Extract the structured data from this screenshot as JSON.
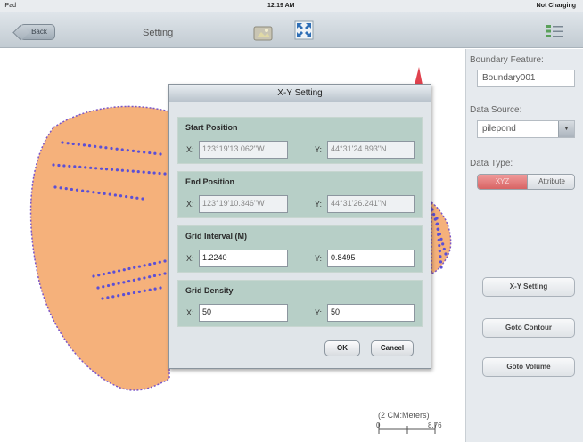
{
  "status_bar": {
    "device": "iPad",
    "time": "12:19 AM",
    "battery": "Not Charging"
  },
  "nav": {
    "back_label": "Back",
    "title": "Setting"
  },
  "icons": {
    "wifi": "wifi-icon",
    "picture": "landscape-picture-icon",
    "fullscreen": "fullscreen-arrows-icon",
    "list": "legend-list-icon"
  },
  "right_panel": {
    "boundary_feature_label": "Boundary Feature:",
    "boundary_feature_value": "Boundary001",
    "data_source_label": "Data Source:",
    "data_source_value": "pilepond",
    "data_type_label": "Data Type:",
    "data_type_options": [
      "XYZ",
      "Attribute"
    ],
    "data_type_selected": "XYZ",
    "buttons": {
      "xy_setting": "X-Y Setting",
      "goto_contour": "Goto Contour",
      "goto_volume": "Goto Volume"
    }
  },
  "dialog": {
    "title": "X-Y Setting",
    "start_position": {
      "label": "Start Position",
      "x_label": "X:",
      "x_value": "123°19'13.062\"W",
      "y_label": "Y:",
      "y_value": "44°31'24.893\"N"
    },
    "end_position": {
      "label": "End Position",
      "x_label": "X:",
      "x_value": "123°19'10.346\"W",
      "y_label": "Y:",
      "y_value": "44°31'26.241\"N"
    },
    "grid_interval": {
      "label": "Grid Interval (M)",
      "x_label": "X:",
      "x_value": "1.2240",
      "y_label": "Y:",
      "y_value": "0.8495"
    },
    "grid_density": {
      "label": "Grid Density",
      "x_label": "X:",
      "x_value": "50",
      "y_label": "Y:",
      "y_value": "50"
    },
    "ok_label": "OK",
    "cancel_label": "Cancel"
  },
  "map": {
    "scale_label": "(2 CM:Meters)",
    "scale_min": "0",
    "scale_max": "8.76",
    "colors": {
      "fill": "#f5b17b",
      "outline": "#7a56c8",
      "points": "#5b4fd6",
      "north_arrow": "#e0424e"
    }
  }
}
